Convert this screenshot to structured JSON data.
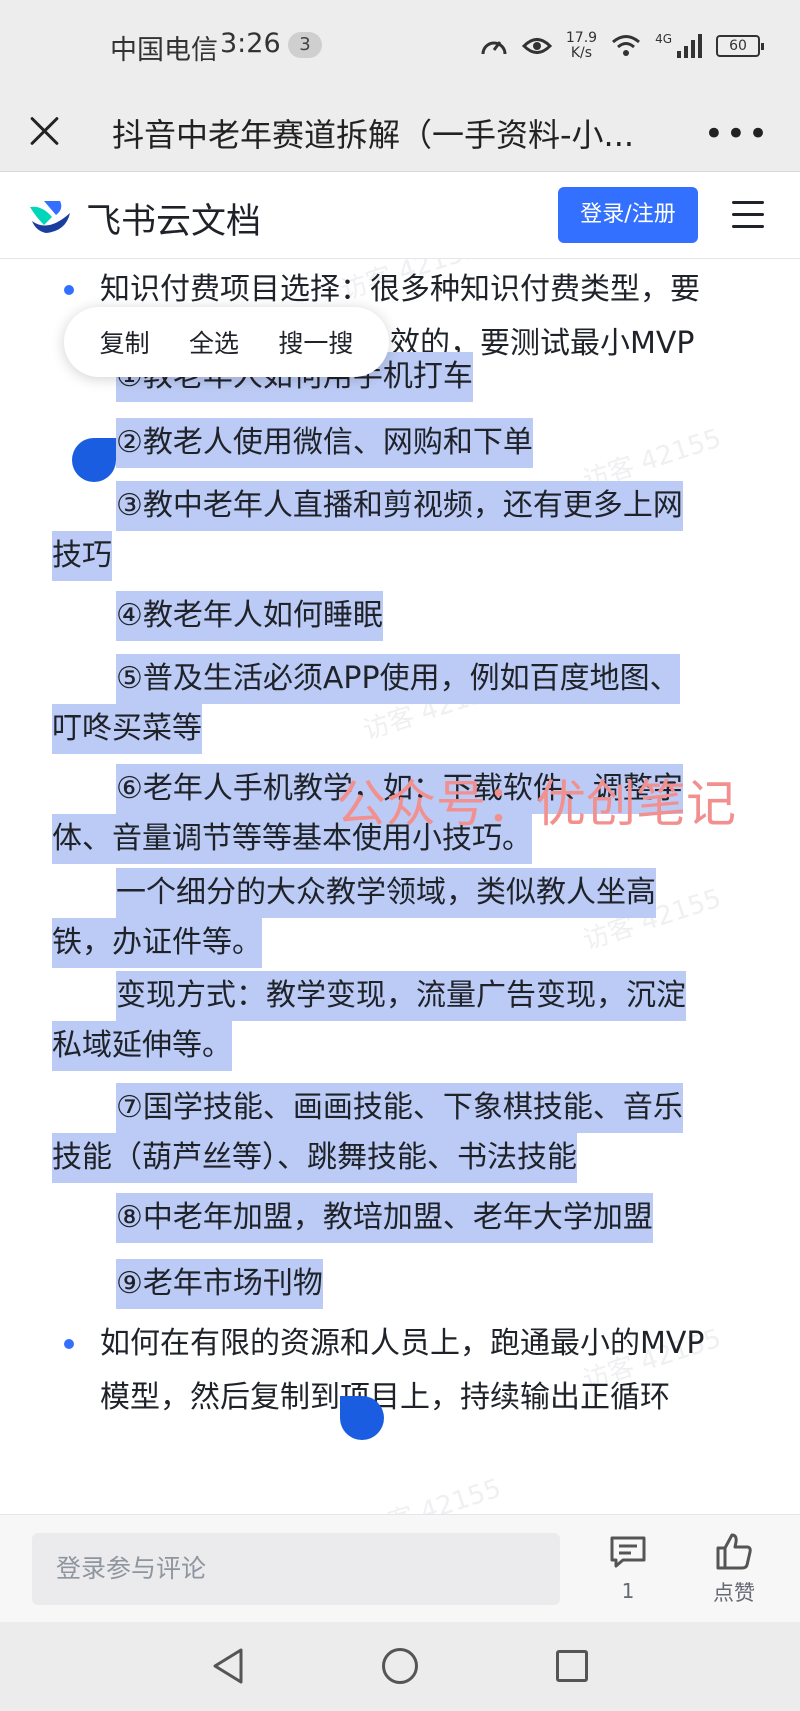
{
  "status_bar": {
    "carrier": "中国电信",
    "time": "3:26",
    "notif_count": "3",
    "net_speed_value": "17.9",
    "net_speed_unit": "K/s",
    "network_type": "4G",
    "battery": "60"
  },
  "title_bar": {
    "title": "抖音中老年赛道拆解（一手资料-小...",
    "more": "•••"
  },
  "app_header": {
    "brand": "飞书云文档",
    "login_label": "登录/注册"
  },
  "context_menu": {
    "copy": "复制",
    "select_all": "全选",
    "search": "搜一搜"
  },
  "doc": {
    "bullet1_line1": "知识付费项目选择：很多种知识付费类型，要",
    "bullet1_line2": "效的，要测试最小MVP",
    "items": [
      {
        "l1": "①教老年人如何用手机打车"
      },
      {
        "l1": "②教老人使用微信、网购和下单"
      },
      {
        "l1": "③教中老年人直播和剪视频，还有更多上网",
        "l2": "技巧"
      },
      {
        "l1": "④教老年人如何睡眠"
      },
      {
        "l1": "⑤普及生活必须APP使用，例如百度地图、",
        "l2": "叮咚买菜等"
      },
      {
        "l1": "⑥老年人手机教学，如：下载软件、调整字",
        "l2": "体、音量调节等等基本使用小技巧。"
      },
      {
        "l1": "一个细分的大众教学领域，类似教人坐高",
        "l2": "铁，办证件等。"
      },
      {
        "l1": "变现方式：教学变现，流量广告变现，沉淀",
        "l2": "私域延伸等。"
      },
      {
        "l1": "⑦国学技能、画画技能、下象棋技能、音乐",
        "l2": "技能（葫芦丝等）、跳舞技能、书法技能"
      },
      {
        "l1": "⑧中老年加盟，教培加盟、老年大学加盟"
      },
      {
        "l1": "⑨老年市场刊物"
      }
    ],
    "bullet2_line1": "如何在有限的资源和人员上，跑通最小的MVP",
    "bullet2_line2": "模型，然后复制到项目上，持续输出正循环",
    "promo_overlay": "公众号：优创笔记",
    "watermark": "访客 42155"
  },
  "comment_bar": {
    "placeholder": "登录参与评论",
    "comment_count": "1",
    "like_label": "点赞"
  },
  "colors": {
    "accent": "#3370ff",
    "selection": "#bccbf5",
    "handle": "#1a5de0",
    "promo": "#f28f8f"
  }
}
